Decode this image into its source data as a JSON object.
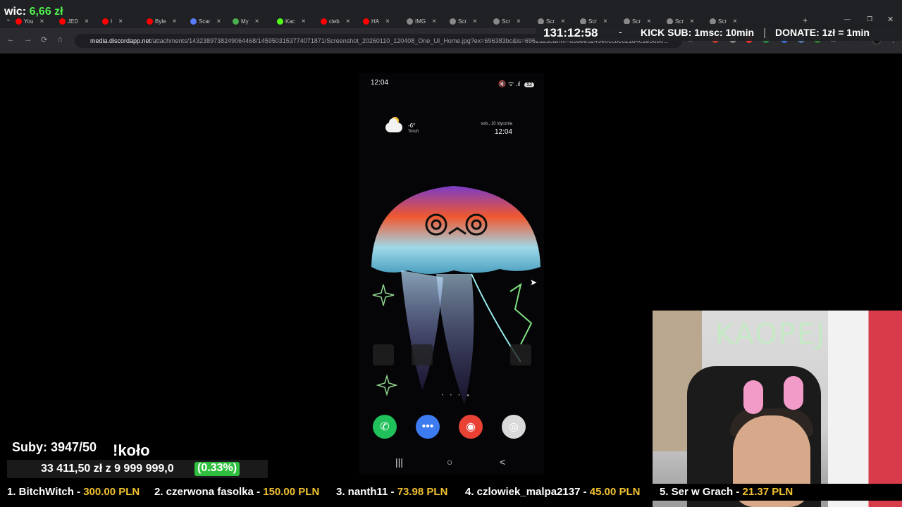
{
  "overlay": {
    "wic_label": "wic:",
    "wic_amount": "6,66 zł",
    "timer": "131:12:58",
    "dash": "-",
    "kick_sub": "KICK SUB: 1msc: 10min",
    "donate": "DONATE: 1zł = 1min",
    "subs": "Suby: 3947/50",
    "kolo": "!koło",
    "goal_text": "33 411,50 zł z  9 999 999,0",
    "goal_pct": "(0.33%)"
  },
  "browser": {
    "tabs": [
      {
        "label": "You",
        "color": "#ff0000"
      },
      {
        "label": "JED",
        "color": "#ff0000"
      },
      {
        "label": "I",
        "color": "#ff0000"
      },
      {
        "label": "Byle",
        "color": "#ff0000"
      },
      {
        "label": "Scar",
        "color": "#5b7cff"
      },
      {
        "label": "My",
        "color": "#4caf50"
      },
      {
        "label": "Kac",
        "color": "#53fc18"
      },
      {
        "label": "cieb",
        "color": "#ff0000"
      },
      {
        "label": "HA",
        "color": "#ff0000"
      },
      {
        "label": "IMG",
        "color": "#888888"
      },
      {
        "label": "Scr",
        "color": "#888888"
      },
      {
        "label": "Scr",
        "color": "#888888"
      },
      {
        "label": "Scr",
        "color": "#888888"
      },
      {
        "label": "Scr",
        "color": "#888888"
      },
      {
        "label": "Scr",
        "color": "#888888"
      },
      {
        "label": "Scr",
        "color": "#888888"
      },
      {
        "label": "Scr",
        "color": "#888888"
      }
    ],
    "new_tab": "+",
    "url_host": "media.discordapp.net",
    "url_path": "/attachments/1432389738249064468/1459503153774071871/Screenshot_20260110_120408_One_UI_Home.jpg?ex=696383bc&is=6962323c&hm=d5dee5249e0ccbc621d4c1e5690..."
  },
  "phone": {
    "time": "12:04",
    "status_icons": "🔇 ᯤ .ıl",
    "battery": "52",
    "temp": "-6°",
    "city": "Toruń",
    "date": "sob., 10 stycznia",
    "clock": "12:04",
    "page_dots": "• • • ●",
    "dock_apps": [
      {
        "name": "phone",
        "glyph": "✆",
        "color": "#20c05a"
      },
      {
        "name": "messages",
        "glyph": "•••",
        "color": "#3d7bf0"
      },
      {
        "name": "chrome",
        "glyph": "◉",
        "color": "#e94235"
      },
      {
        "name": "camera",
        "glyph": "◎",
        "color": "#d9d9d9"
      }
    ],
    "nav": {
      "recent": "|||",
      "home": "○",
      "back": "<"
    }
  },
  "webcam": {
    "neon_text": "KAOPEJ"
  },
  "ticker": [
    {
      "name": "1. BitchWitch - ",
      "amount": "300.00 PLN"
    },
    {
      "name": "2. czerwona fasolka - ",
      "amount": "150.00 PLN"
    },
    {
      "name": "3. nanth11 - ",
      "amount": "73.98 PLN"
    },
    {
      "name": "4. czlowiek_malpa2137 - ",
      "amount": "45.00 PLN"
    },
    {
      "name": "5. Ser w Grach - ",
      "amount": "21.37 PLN"
    }
  ],
  "colors": {
    "accent_green": "#4ef04e",
    "ticker_amount": "#f2c230",
    "goal_pct_bg": "#2fbf3f"
  }
}
